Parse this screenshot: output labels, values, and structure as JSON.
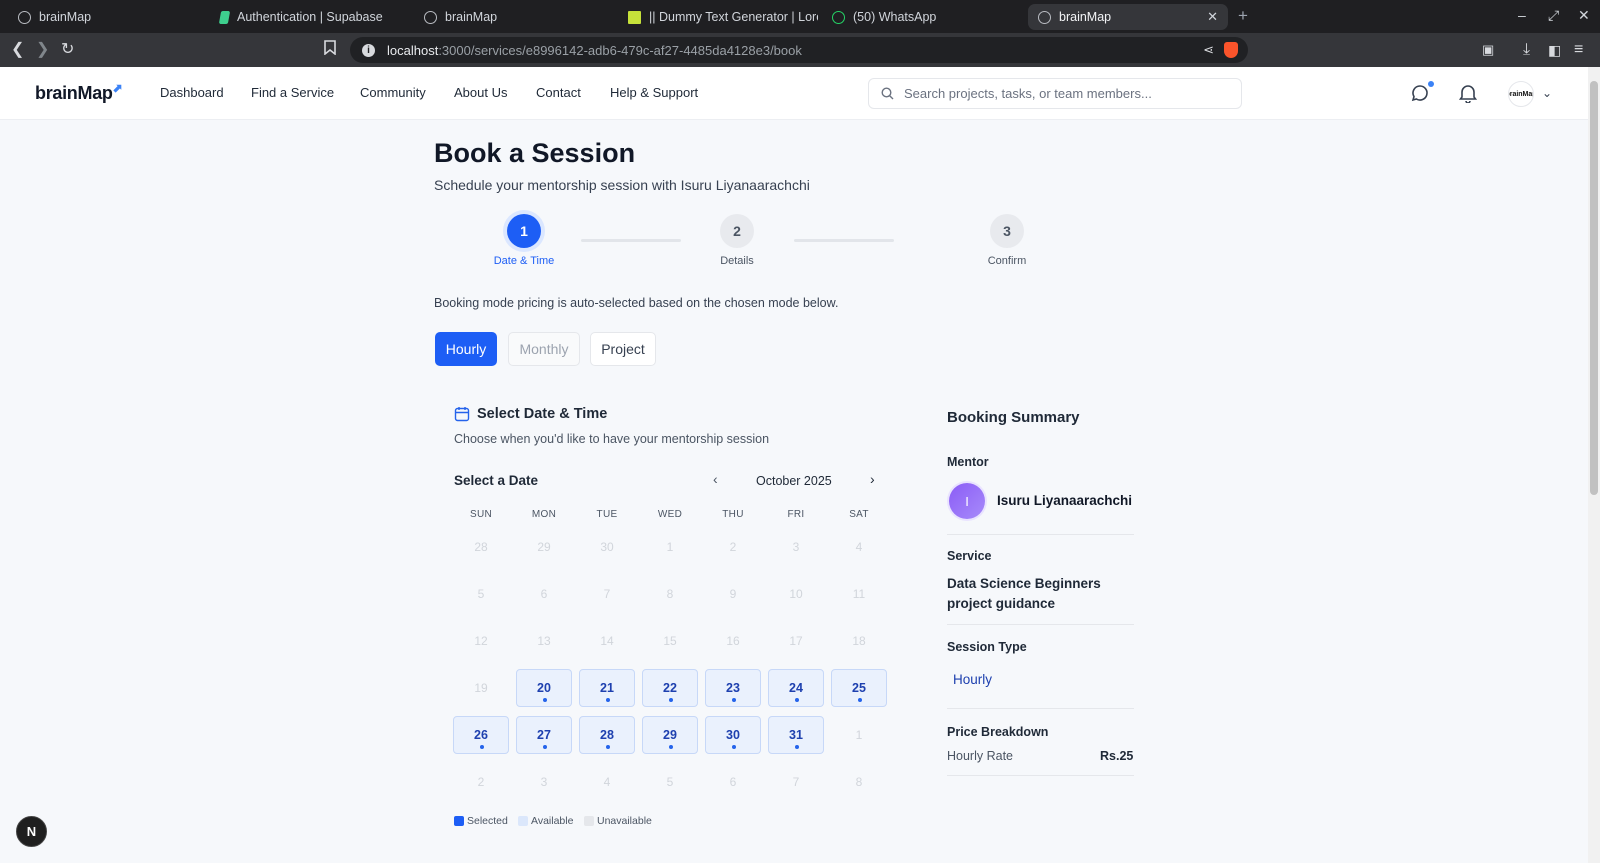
{
  "browser": {
    "tabs": [
      {
        "label": "brainMap",
        "icon": "globe-icon"
      },
      {
        "label": "Authentication | Supabase",
        "icon": "supabase-icon"
      },
      {
        "label": "brainMap",
        "icon": "globe-icon"
      },
      {
        "label": "|| Dummy Text Generator | Lore",
        "icon": "dummy-text-icon"
      },
      {
        "label": "(50) WhatsApp",
        "icon": "whatsapp-icon"
      },
      {
        "label": "brainMap",
        "icon": "globe-icon",
        "active": true
      }
    ],
    "url_host": "localhost",
    "url_path": ":3000/services/e8996142-adb6-479c-af27-4485da4128e3/book"
  },
  "header": {
    "logo": "brainMap",
    "nav": [
      "Dashboard",
      "Find a Service",
      "Community",
      "About Us",
      "Contact",
      "Help & Support"
    ],
    "search_placeholder": "Search projects, tasks, or team members...",
    "avatar_text": "brainMap"
  },
  "page": {
    "title": "Book a Session",
    "subtitle": "Schedule your mentorship session with Isuru Liyanaarachchi",
    "steps": [
      {
        "num": "1",
        "label": "Date & Time",
        "active": true
      },
      {
        "num": "2",
        "label": "Details"
      },
      {
        "num": "3",
        "label": "Confirm"
      }
    ],
    "note": "Booking mode pricing is auto-selected based on the chosen mode below.",
    "modes": [
      "Hourly",
      "Monthly",
      "Project"
    ],
    "selected_mode": "Hourly"
  },
  "calendar": {
    "section_title": "Select Date & Time",
    "section_sub": "Choose when you'd like to have your mentorship session",
    "select_label": "Select a Date",
    "month": "October 2025",
    "weekdays": [
      "SUN",
      "MON",
      "TUE",
      "WED",
      "THU",
      "FRI",
      "SAT"
    ],
    "weeks": [
      [
        "28",
        "29",
        "30",
        "1",
        "2",
        "3",
        "4"
      ],
      [
        "5",
        "6",
        "7",
        "8",
        "9",
        "10",
        "11"
      ],
      [
        "12",
        "13",
        "14",
        "15",
        "16",
        "17",
        "18"
      ],
      [
        "19",
        "20",
        "21",
        "22",
        "23",
        "24",
        "25"
      ],
      [
        "26",
        "27",
        "28",
        "29",
        "30",
        "31",
        "1"
      ],
      [
        "2",
        "3",
        "4",
        "5",
        "6",
        "7",
        "8"
      ]
    ],
    "available": [
      "20",
      "21",
      "22",
      "23",
      "24",
      "25",
      "26",
      "27",
      "28",
      "29",
      "30",
      "31"
    ],
    "legend": [
      "Selected",
      "Available",
      "Unavailable"
    ],
    "colors": {
      "selected": "#1d5ef5",
      "available": "#dbe7fb",
      "unavailable": "#e5e7eb"
    }
  },
  "summary": {
    "title": "Booking Summary",
    "mentor_label": "Mentor",
    "mentor_initial": "I",
    "mentor_name": "Isuru Liyanaarachchi",
    "service_label": "Service",
    "service_name": "Data Science Beginners project guidance",
    "session_type_label": "Session Type",
    "session_type": "Hourly",
    "price_label": "Price Breakdown",
    "rate_label": "Hourly Rate",
    "rate_value": "Rs.25"
  },
  "dev_badge": "N"
}
